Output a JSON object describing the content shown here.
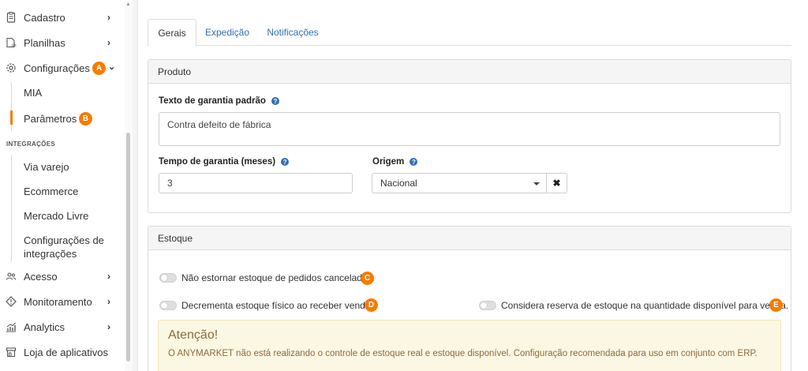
{
  "sidebar": {
    "items": [
      {
        "label": "Cadastro",
        "icon": "clipboard-icon"
      },
      {
        "label": "Planilhas",
        "icon": "spreadsheet-icon"
      },
      {
        "label": "Configurações",
        "icon": "gear-icon",
        "badge": "A"
      },
      {
        "label": "Acesso",
        "icon": "users-icon"
      },
      {
        "label": "Monitoramento",
        "icon": "diamond-icon"
      },
      {
        "label": "Analytics",
        "icon": "analytics-icon"
      },
      {
        "label": "Loja de aplicativos",
        "icon": "store-icon"
      }
    ],
    "config_sub": [
      {
        "label": "MIA"
      },
      {
        "label": "Parâmetros",
        "badge": "B",
        "active": true
      }
    ],
    "integrations_title": "INTEGRAÇÕES",
    "integrations": [
      {
        "label": "Via varejo"
      },
      {
        "label": "Ecommerce"
      },
      {
        "label": "Mercado Livre"
      },
      {
        "label": "Configurações de"
      },
      {
        "label": "integrações"
      }
    ]
  },
  "tabs": [
    {
      "label": "Gerais",
      "active": true
    },
    {
      "label": "Expedição"
    },
    {
      "label": "Notificações"
    }
  ],
  "produto": {
    "title": "Produto",
    "warranty_text_label": "Texto de garantia padrão",
    "warranty_text_value": "Contra defeito de fábrica",
    "warranty_time_label": "Tempo de garantia (meses)",
    "warranty_time_value": "3",
    "origin_label": "Origem",
    "origin_value": "Nacional",
    "clear_symbol": "✖"
  },
  "estoque": {
    "title": "Estoque",
    "toggle_c": {
      "label": "Não estornar estoque de pedidos cancelados.",
      "badge": "C",
      "on": false
    },
    "toggle_d": {
      "label": "Decrementa estoque físico ao receber vendas.",
      "badge": "D",
      "on": false
    },
    "toggle_e": {
      "label": "Considera reserva de estoque na quantidade disponível para venda.",
      "badge": "E",
      "on": false
    },
    "alert_title": "Atenção!",
    "alert_text": "O ANYMARKET não está realizando o controle de estoque real e estoque disponível. Configuração recomendada para uso em conjunto com ERP."
  },
  "colors": {
    "accent": "#f57c00",
    "link": "#2f6fb5",
    "alert_bg": "#fcf7e3",
    "alert_text": "#8a6d3b"
  }
}
